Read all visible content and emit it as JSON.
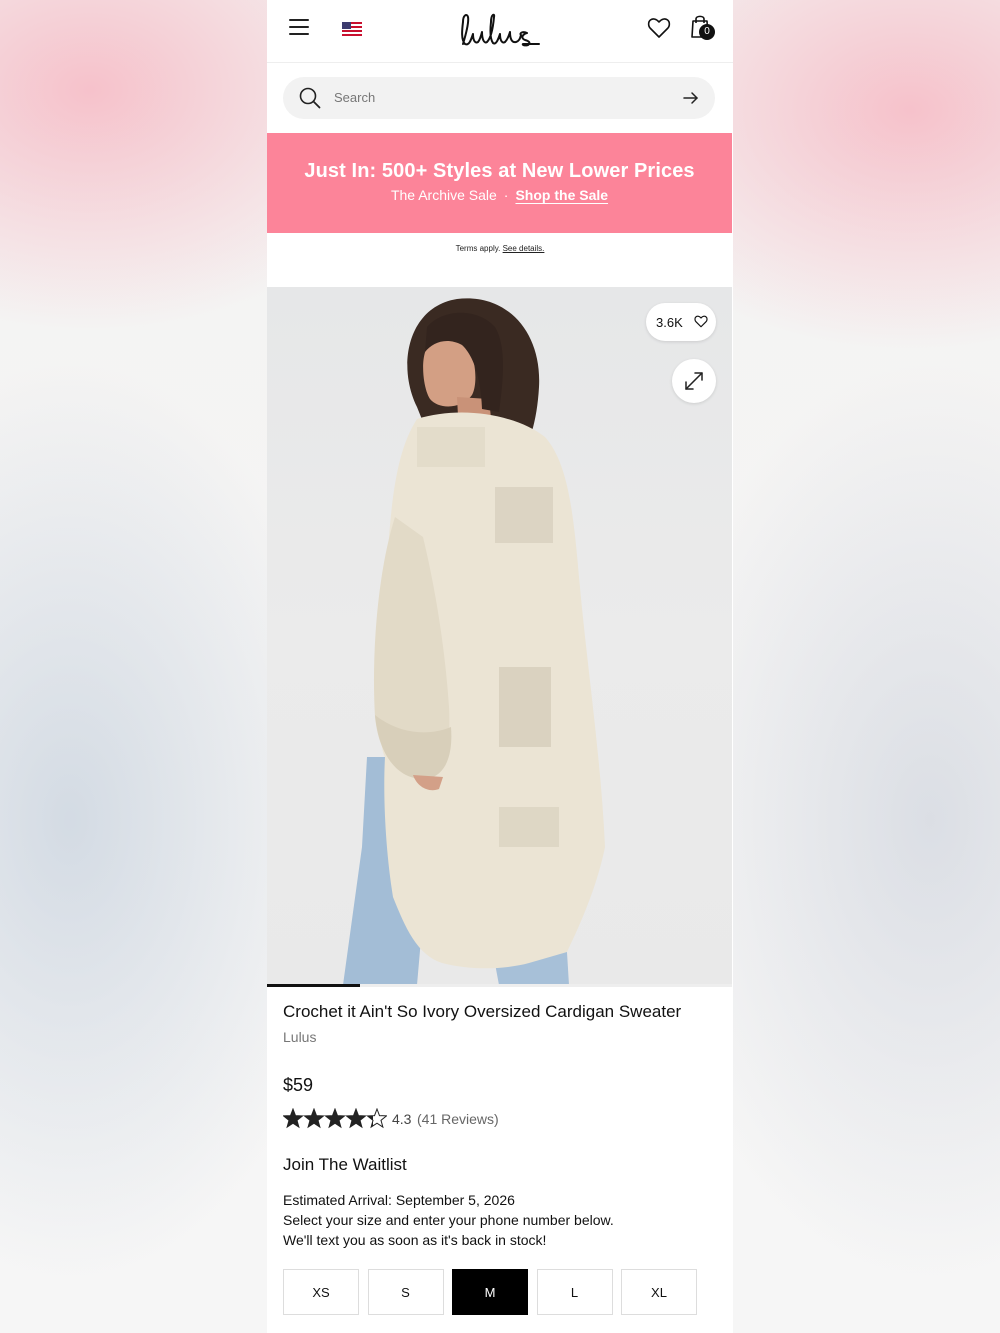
{
  "header": {
    "logo_text": "Lulus",
    "bag_count": "0"
  },
  "search": {
    "placeholder": "Search"
  },
  "promo": {
    "headline": "Just In: 500+ Styles at New Lower Prices",
    "subline": "The Archive Sale",
    "separator": "·",
    "link": "Shop the Sale",
    "background_color": "#fc8499"
  },
  "terms": {
    "text": "Terms apply.",
    "link": "See details."
  },
  "image": {
    "likes": "3.6K",
    "carousel_progress": 0.2
  },
  "product": {
    "title": "Crochet it Ain't So Ivory Oversized Cardigan Sweater",
    "brand": "Lulus",
    "price": "$59",
    "rating": "4.3",
    "rating_stars_filled": 4.3,
    "rating_max": 5,
    "reviews": "(41 Reviews)"
  },
  "waitlist": {
    "title": "Join The Waitlist",
    "arrival": "Estimated Arrival: September 5, 2026",
    "line1": "Select your size and enter your phone number below.",
    "line2": "We'll text you as soon as it's back in stock!"
  },
  "sizes": {
    "options": [
      "XS",
      "S",
      "M",
      "L",
      "XL"
    ],
    "selected": "M"
  },
  "icons": {
    "menu": "hamburger-menu-icon",
    "flag": "us-flag-icon",
    "wishlist": "heart-outline-icon",
    "bag": "shopping-bag-icon",
    "search": "search-icon",
    "search_submit": "arrow-right-icon",
    "likes": "heart-outline-icon",
    "expand": "expand-arrows-icon",
    "rating": "star-icon"
  }
}
